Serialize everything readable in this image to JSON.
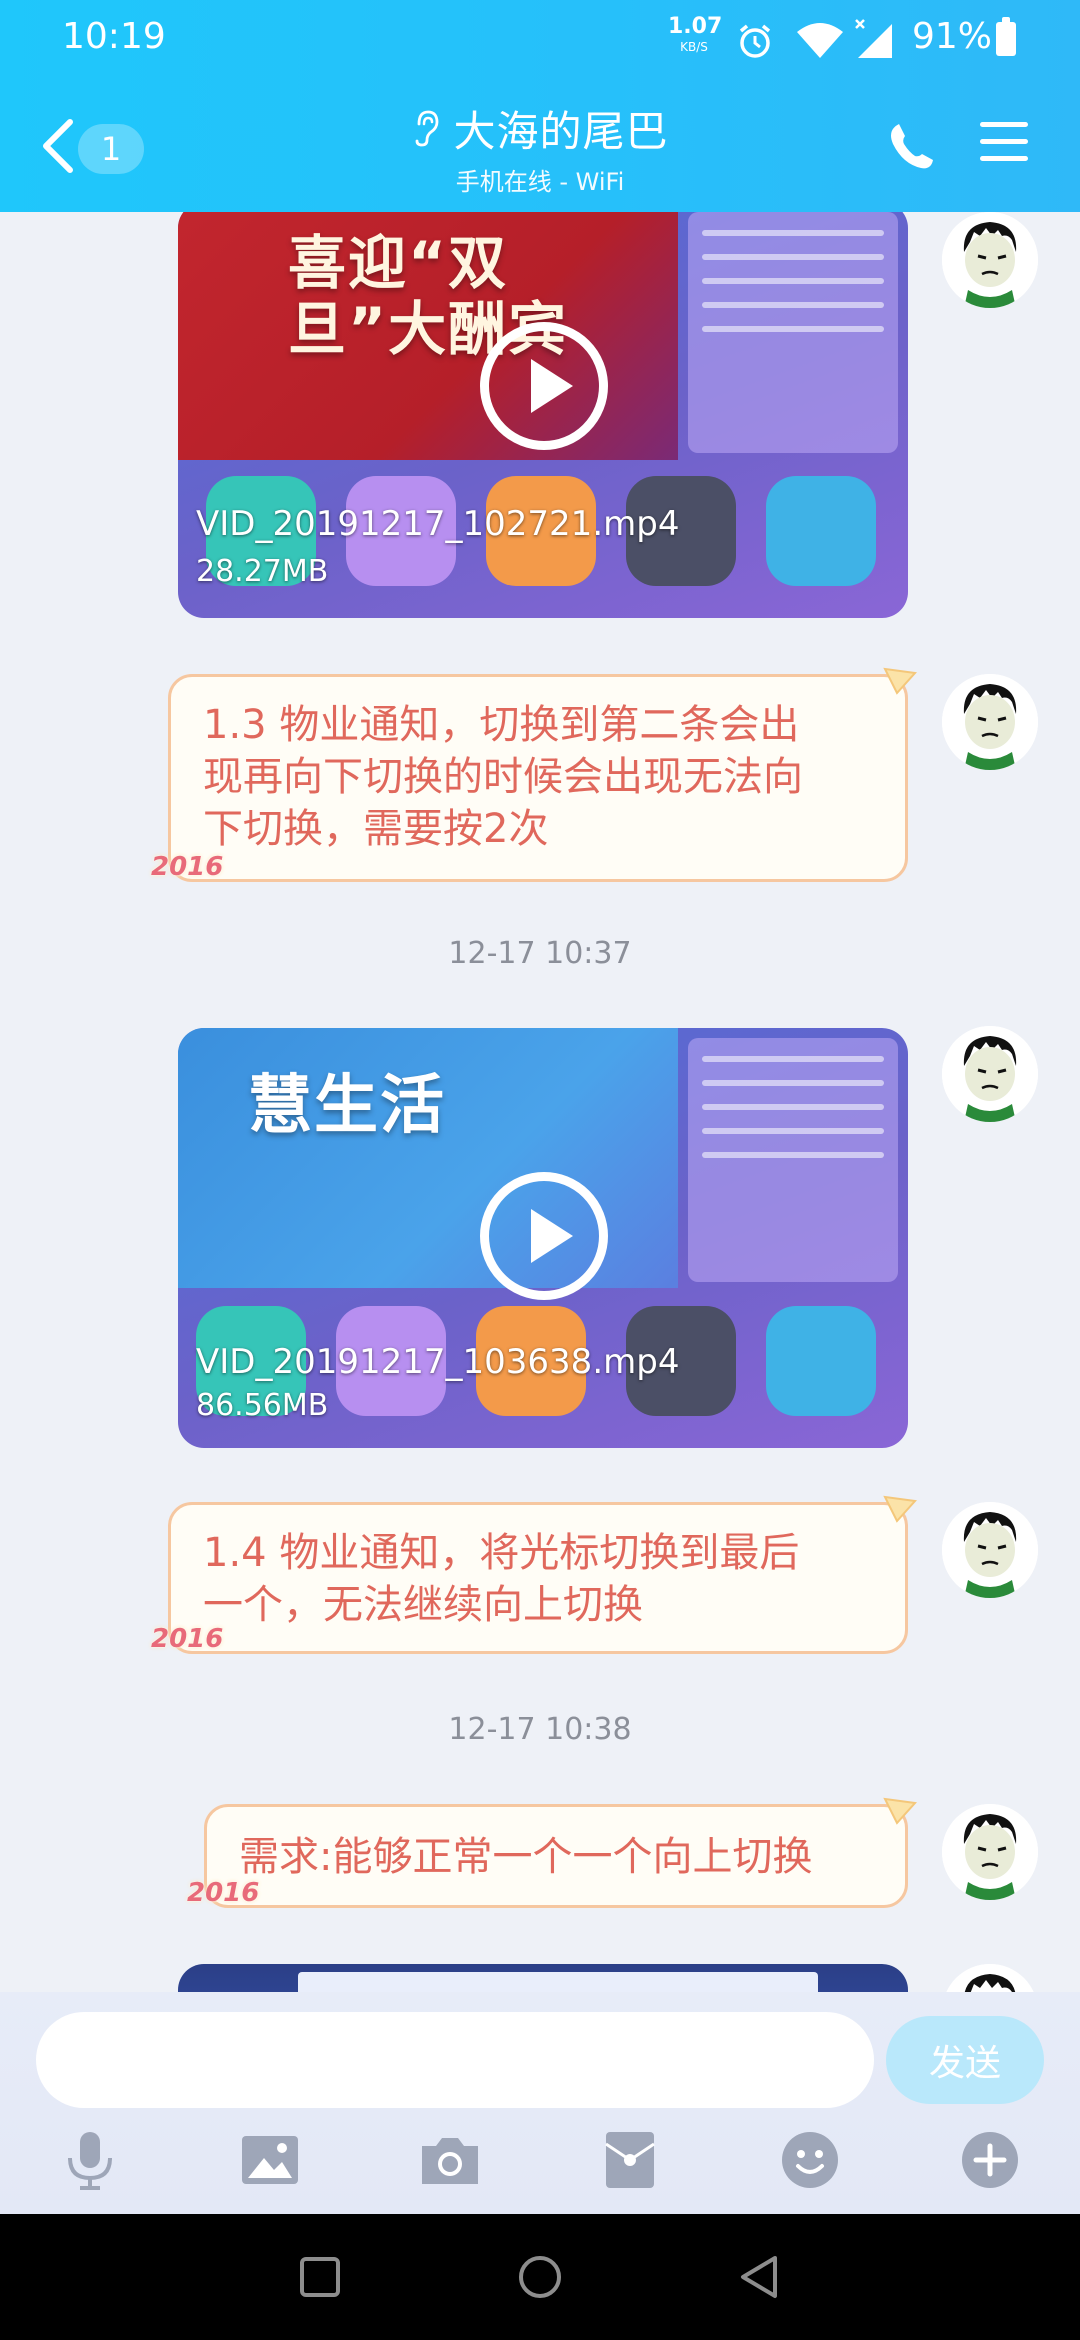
{
  "status_bar": {
    "time": "10:19",
    "net_speed": "1.07",
    "net_unit": "KB/S",
    "battery": "91%",
    "icons": [
      "alarm-icon",
      "wifi-icon",
      "signal-icon",
      "battery-icon"
    ]
  },
  "header": {
    "unread_count": "1",
    "contact_name": "大海的尾巴",
    "online_status": "手机在线 - WiFi",
    "background_color": "#26c0fa"
  },
  "messages": [
    {
      "type": "video",
      "filename": "VID_20191217_102721.mp4",
      "size": "28.27MB",
      "poster_text": "喜迎“双旦”大酬宾"
    },
    {
      "type": "text",
      "text": "1.3 物业通知，切换到第二条会出现再向下切换的时候会出现无法向下切换，需要按2次",
      "lines": [
        "1.3 物业通知，切换到第二条会出",
        "现再向下切换的时候会出现无法向",
        "下切换，需要按2次"
      ]
    },
    {
      "type": "timestamp",
      "text": "12-17 10:37"
    },
    {
      "type": "video",
      "filename": "VID_20191217_103638.mp4",
      "size": "86.56MB",
      "poster_text": "慧生活"
    },
    {
      "type": "text",
      "text": "1.4 物业通知，将光标切换到最后一个，无法继续向上切换",
      "lines": [
        "1.4 物业通知，将光标切换到最后",
        "一个，无法继续向上切换"
      ]
    },
    {
      "type": "timestamp",
      "text": "12-17 10:38"
    },
    {
      "type": "text",
      "text": "需求:能够正常一个一个向上切换",
      "lines": [
        "需求:能够正常一个一个向上切换"
      ]
    }
  ],
  "bubble_decoration": "2016",
  "bubble_colors": {
    "text": "#e0685c",
    "border": "#f6c7a0",
    "background": "#fffdf6"
  },
  "input_bar": {
    "message_value": "",
    "send_label": "发送",
    "tools": [
      "microphone-icon",
      "image-icon",
      "camera-icon",
      "red-packet-icon",
      "emoji-icon",
      "plus-icon"
    ]
  },
  "nav_bar": [
    "recents-button",
    "home-button",
    "back-button"
  ]
}
